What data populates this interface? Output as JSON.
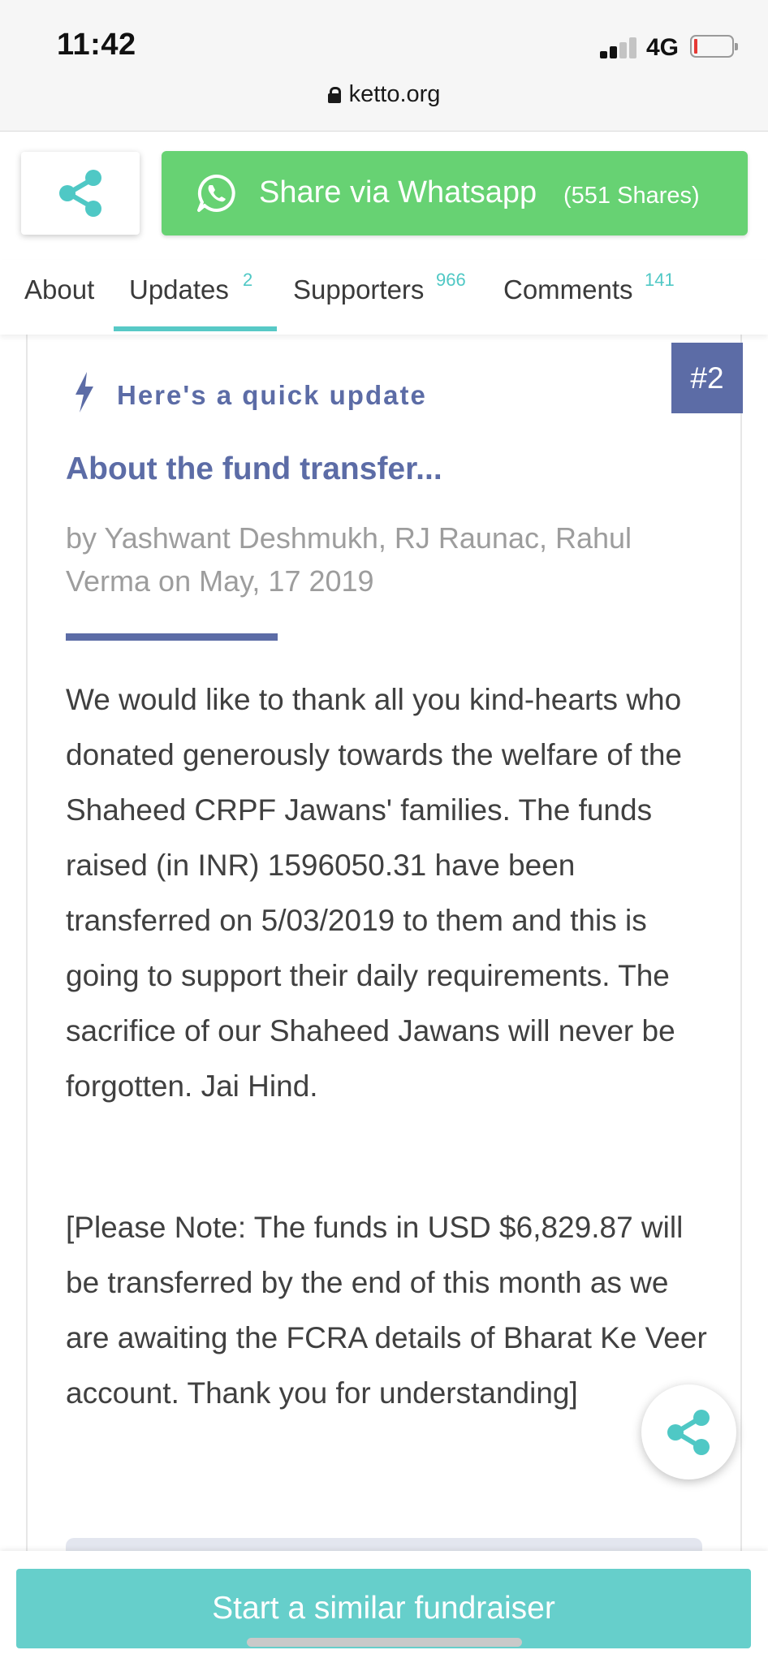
{
  "status_bar": {
    "time": "11:42",
    "network": "4G"
  },
  "browser": {
    "url": "ketto.org"
  },
  "share": {
    "whatsapp_label": "Share via Whatsapp",
    "whatsapp_count": "(551 Shares)"
  },
  "tabs": [
    {
      "label": "About",
      "count": ""
    },
    {
      "label": "Updates",
      "count": "2"
    },
    {
      "label": "Supporters",
      "count": "966"
    },
    {
      "label": "Comments",
      "count": "141"
    }
  ],
  "active_tab": "Updates",
  "update": {
    "badge": "#2",
    "quick_label": "Here's a quick update",
    "title": "About the fund transfer...",
    "byline": "by Yashwant Deshmukh, RJ Raunac, Rahul Verma on May, 17 2019",
    "paragraphs": [
      "We would like to thank all you kind-hearts who donated generously towards the welfare of the Shaheed CRPF Jawans' families. The funds raised (in INR) 1596050.31 have been transferred on 5/03/2019 to them and this is going to support their daily requirements. The sacrifice of our Shaheed Jawans will never be forgotten. Jai Hind.",
      "[Please Note: The funds in USD $6,829.87 will be transferred by the end of this month as we are awaiting the FCRA details of Bharat Ke Veer account. Thank you for understanding]"
    ]
  },
  "cta": {
    "label": "Start a similar fundraiser"
  },
  "colors": {
    "accent_teal": "#57c9c6",
    "whatsapp_green": "#67d273",
    "update_blue": "#5c6ca6"
  },
  "icons": [
    "lock-icon",
    "share-icon",
    "whatsapp-icon",
    "bolt-icon"
  ]
}
